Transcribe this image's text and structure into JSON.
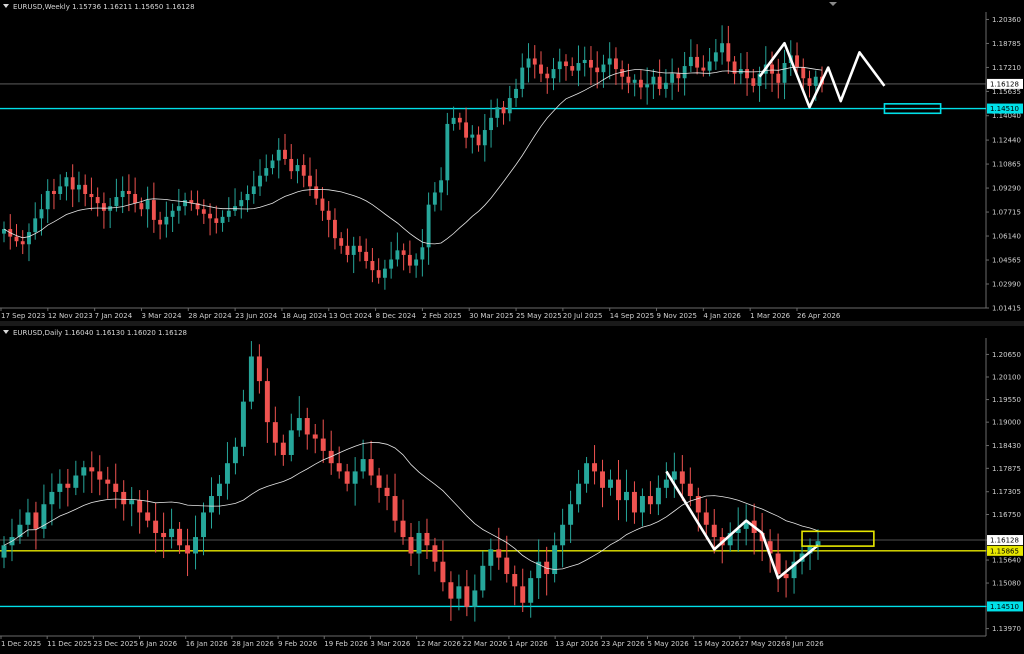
{
  "chart_data": [
    {
      "id": "weekly",
      "type": "candlestick",
      "title": "EURUSD,Weekly",
      "ohlc_label": "1.15736 1.16211 1.15650 1.16128",
      "ylim": [
        1.01415,
        1.2085
      ],
      "price_ticks": [
        "1.20360",
        "1.18785",
        "1.17210",
        "1.15635",
        "1.14040",
        "1.12440",
        "1.10865",
        "1.09290",
        "1.07715",
        "1.06140",
        "1.04565",
        "1.02990",
        "1.01415"
      ],
      "price_tick_values": [
        1.2036,
        1.18785,
        1.1721,
        1.15635,
        1.1404,
        1.1244,
        1.10865,
        1.0929,
        1.07715,
        1.0614,
        1.04565,
        1.0299,
        1.01415
      ],
      "date_ticks": [
        "17 Sep 2023",
        "12 Nov 2023",
        "7 Jan 2024",
        "3 Mar 2024",
        "28 Apr 2024",
        "23 Jun 2024",
        "18 Aug 2024",
        "13 Oct 2024",
        "8 Dec 2024",
        "2 Feb 2025",
        "30 Mar 2025",
        "25 May 2025",
        "20 Jul 2025",
        "14 Sep 2025",
        "9 Nov 2025",
        "4 Jan 2026",
        "1 Mar 2026",
        "26 Apr 2026"
      ],
      "closes": [
        1.066,
        1.061,
        1.058,
        1.056,
        1.064,
        1.073,
        1.079,
        1.091,
        1.089,
        1.094,
        1.1,
        1.092,
        1.095,
        1.089,
        1.087,
        1.083,
        1.078,
        1.081,
        1.087,
        1.091,
        1.089,
        1.083,
        1.079,
        1.085,
        1.072,
        1.069,
        1.074,
        1.078,
        1.081,
        1.085,
        1.083,
        1.079,
        1.076,
        1.073,
        1.07,
        1.074,
        1.078,
        1.081,
        1.085,
        1.089,
        1.094,
        1.101,
        1.106,
        1.111,
        1.118,
        1.112,
        1.104,
        1.108,
        1.101,
        1.094,
        1.086,
        1.078,
        1.072,
        1.06,
        1.055,
        1.049,
        1.055,
        1.051,
        1.045,
        1.039,
        1.034,
        1.04,
        1.046,
        1.052,
        1.049,
        1.042,
        1.046,
        1.054,
        1.082,
        1.09,
        1.098,
        1.135,
        1.139,
        1.136,
        1.126,
        1.128,
        1.121,
        1.131,
        1.139,
        1.146,
        1.142,
        1.152,
        1.158,
        1.172,
        1.178,
        1.174,
        1.168,
        1.165,
        1.171,
        1.176,
        1.173,
        1.17,
        1.175,
        1.177,
        1.172,
        1.169,
        1.174,
        1.178,
        1.171,
        1.166,
        1.162,
        1.164,
        1.159,
        1.161,
        1.166,
        1.158,
        1.162,
        1.168,
        1.165,
        1.173,
        1.179,
        1.172,
        1.17,
        1.176,
        1.182,
        1.188,
        1.176,
        1.168,
        1.171,
        1.165,
        1.16,
        1.168,
        1.174,
        1.168,
        1.162,
        1.175,
        1.18,
        1.172,
        1.165,
        1.16,
        1.166,
        1.161
      ],
      "ma_label": "moving average",
      "levels": [
        {
          "value": 1.1451,
          "label": "1.14510",
          "color": "#00e0e8"
        }
      ],
      "current": {
        "value": 1.16128,
        "label": "1.16128"
      },
      "zigzag": [
        [
          1.166,
          121
        ],
        [
          1.188,
          125
        ],
        [
          1.146,
          129
        ],
        [
          1.172,
          132
        ],
        [
          1.15,
          134
        ],
        [
          1.182,
          137
        ],
        [
          1.16,
          141
        ]
      ],
      "target_box": {
        "color": "#00e0e8",
        "low": 1.142,
        "high": 1.1482,
        "from_index": 141,
        "to_index": 150
      }
    },
    {
      "id": "daily",
      "type": "candlestick",
      "title": "EURUSD,Daily",
      "ohlc_label": "1.16040 1.16130 1.16020 1.16128",
      "ylim": [
        1.1379,
        1.2105
      ],
      "price_ticks": [
        "1.20650",
        "1.20100",
        "1.19550",
        "1.19000",
        "1.18430",
        "1.17875",
        "1.17305",
        "1.16750",
        "1.16128",
        "1.15865",
        "1.15640",
        "1.15080",
        "1.14510",
        "1.13970"
      ],
      "price_tick_values": [
        1.2065,
        1.201,
        1.1955,
        1.19,
        1.1843,
        1.17875,
        1.17305,
        1.1675,
        1.16128,
        1.15865,
        1.1564,
        1.1508,
        1.1451,
        1.1397
      ],
      "date_ticks": [
        "1 Dec 2025",
        "11 Dec 2025",
        "23 Dec 2025",
        "6 Jan 2026",
        "16 Jan 2026",
        "28 Jan 2026",
        "9 Feb 2026",
        "19 Feb 2026",
        "3 Mar 2026",
        "12 Mar 2026",
        "22 Mar 2026",
        "1 Apr 2026",
        "13 Apr 2026",
        "23 Apr 2026",
        "5 May 2026",
        "15 May 2026",
        "27 May 2026",
        "8 Jun 2026"
      ],
      "closes": [
        1.16,
        1.162,
        1.165,
        1.168,
        1.164,
        1.17,
        1.173,
        1.175,
        1.174,
        1.177,
        1.179,
        1.178,
        1.176,
        1.175,
        1.173,
        1.17,
        1.171,
        1.168,
        1.166,
        1.163,
        1.162,
        1.164,
        1.16,
        1.158,
        1.162,
        1.168,
        1.172,
        1.175,
        1.18,
        1.184,
        1.195,
        1.206,
        1.2,
        1.19,
        1.185,
        1.182,
        1.188,
        1.191,
        1.187,
        1.186,
        1.183,
        1.18,
        1.178,
        1.175,
        1.178,
        1.181,
        1.177,
        1.174,
        1.172,
        1.166,
        1.162,
        1.158,
        1.163,
        1.16,
        1.156,
        1.151,
        1.147,
        1.15,
        1.145,
        1.149,
        1.155,
        1.159,
        1.157,
        1.153,
        1.15,
        1.146,
        1.152,
        1.156,
        1.153,
        1.16,
        1.165,
        1.17,
        1.175,
        1.18,
        1.178,
        1.174,
        1.176,
        1.171,
        1.173,
        1.168,
        1.172,
        1.17,
        1.174,
        1.176,
        1.178,
        1.175,
        1.172,
        1.168,
        1.165,
        1.162,
        1.16,
        1.163,
        1.164,
        1.166,
        1.163,
        1.161,
        1.158,
        1.153,
        1.152,
        1.156,
        1.158,
        1.16,
        1.161
      ],
      "ma_label": "moving average",
      "levels": [
        {
          "value": 1.15865,
          "label": "1.15865",
          "color": "#e8e800"
        },
        {
          "value": 1.1451,
          "label": "1.14510",
          "color": "#00e0e8"
        }
      ],
      "current": {
        "value": 1.16128,
        "label": "1.16128"
      },
      "zigzag": [
        [
          1.178,
          83
        ],
        [
          1.159,
          89
        ],
        [
          1.166,
          93
        ],
        [
          1.163,
          95
        ],
        [
          1.152,
          97
        ],
        [
          1.16,
          102
        ]
      ],
      "target_box": {
        "color": "#e8e800",
        "low": 1.1598,
        "high": 1.1634,
        "from_index": 100,
        "to_index": 109
      }
    }
  ]
}
